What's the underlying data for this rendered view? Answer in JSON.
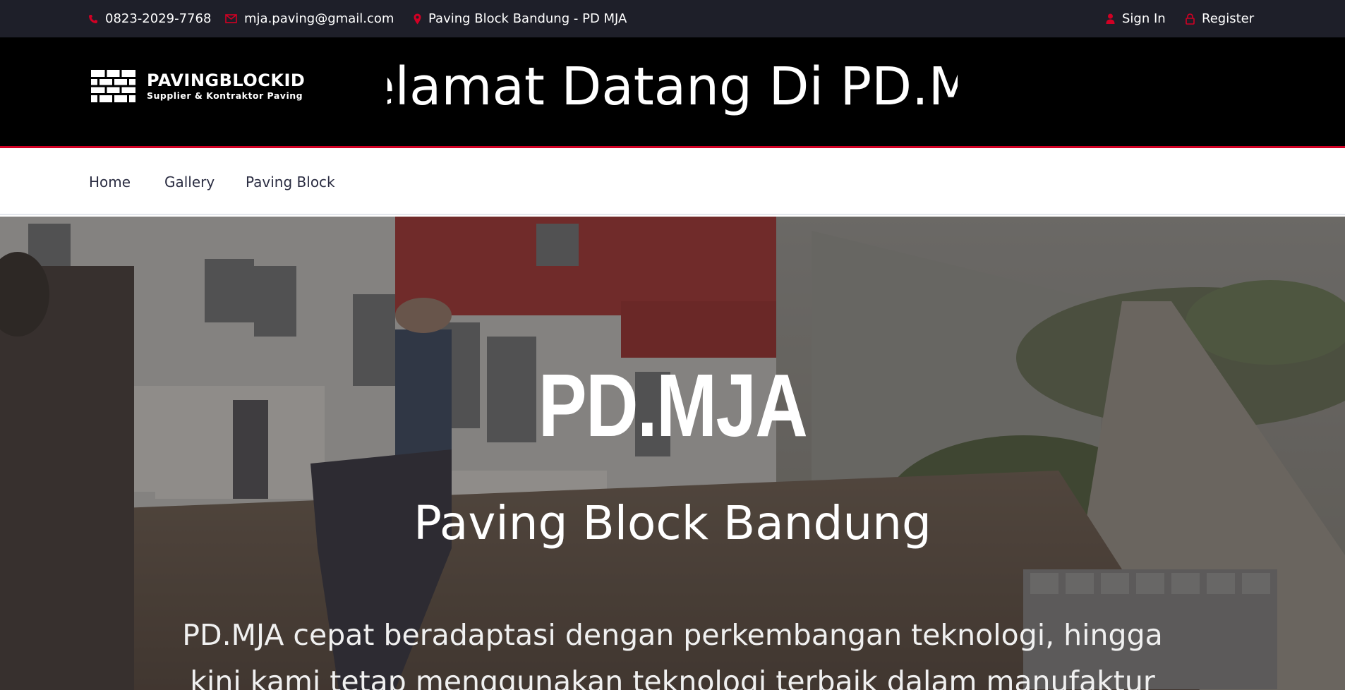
{
  "topbar": {
    "phone": "0823-2029-7768",
    "email": "mja.paving@gmail.com",
    "location": "Paving Block Bandung - PD MJA",
    "sign_in": "Sign In",
    "register": "Register",
    "icons": {
      "phone": "phone-icon",
      "email": "envelope-icon",
      "location": "map-marker-icon",
      "sign_in": "user-icon",
      "register": "lock-icon"
    },
    "accent_color": "#d10024"
  },
  "header": {
    "logo_title": "PAVINGBLOCKID",
    "logo_subtitle": "Supplier & Kontraktor Paving",
    "marquee_text": "Selamat Datang Di PD.MJA"
  },
  "nav": {
    "items": [
      {
        "label": "Home"
      },
      {
        "label": "Gallery"
      },
      {
        "label": "Paving Block"
      }
    ]
  },
  "hero": {
    "title": "PD.MJA",
    "subtitle": "Paving Block Bandung",
    "description": "PD.MJA cepat beradaptasi dengan perkembangan teknologi, hingga kini kami tetap menggunakan teknologi terbaik dalam manufaktur"
  }
}
